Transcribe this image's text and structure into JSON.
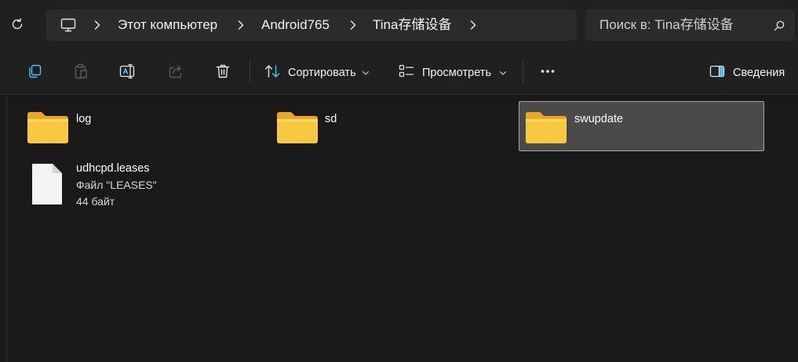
{
  "address_bar": {
    "breadcrumb": [
      "Этот компьютер",
      "Android765",
      "Tina存储设备"
    ],
    "root_icon": "computer-icon",
    "search_placeholder": "Поиск в: Tina存储设备"
  },
  "toolbar": {
    "icons": [
      "copy-icon",
      "paste-icon",
      "rename-icon",
      "share-icon",
      "delete-icon"
    ],
    "sort_label": "Сортировать",
    "view_label": "Просмотреть",
    "more_icon": "more-icon",
    "details_label": "Сведения"
  },
  "items": [
    {
      "name": "log",
      "type": "folder",
      "selected": false
    },
    {
      "name": "sd",
      "type": "folder",
      "selected": false
    },
    {
      "name": "swupdate",
      "type": "folder",
      "selected": true
    },
    {
      "name": "udhcpd.leases",
      "type": "file",
      "kind": "Файл \"LEASES\"",
      "size": "44 байт",
      "selected": false
    }
  ],
  "colors": {
    "background": "#191919",
    "bar": "#202020",
    "field": "#2b2b2b",
    "selection": "#4a4a4a",
    "folder": "#f8c843",
    "accent": "#60cdff"
  }
}
